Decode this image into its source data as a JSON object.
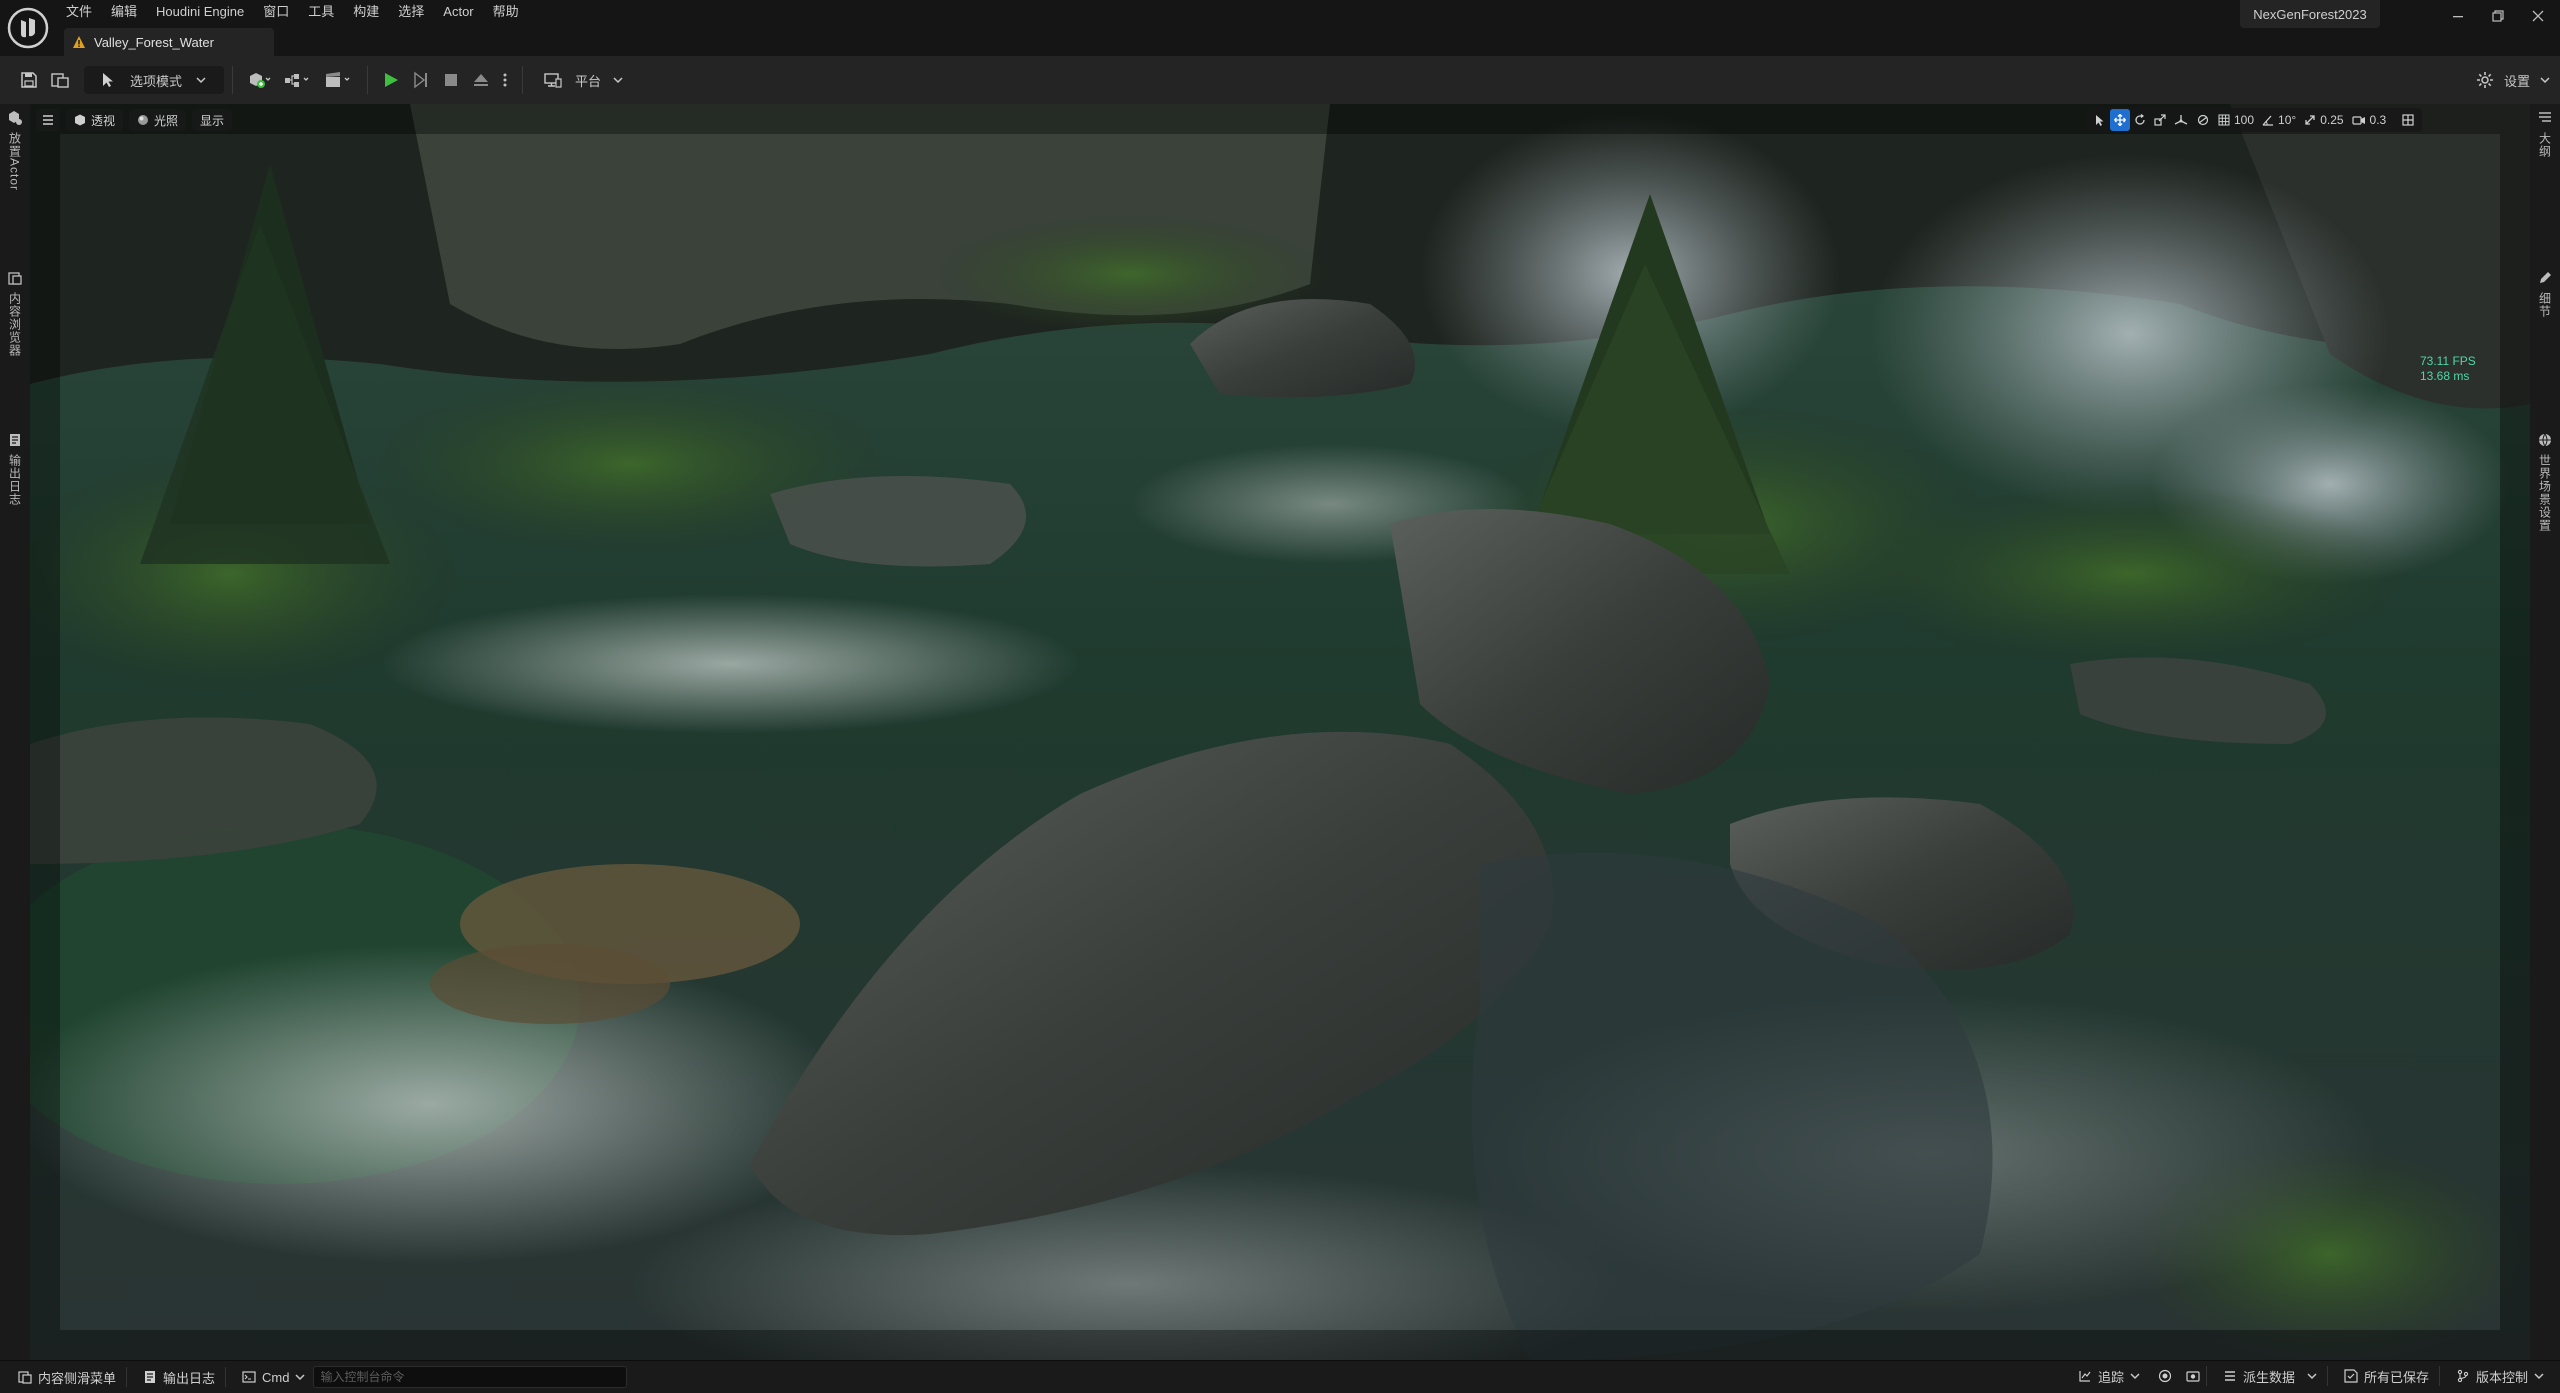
{
  "menu": [
    "文件",
    "编辑",
    "Houdini Engine",
    "窗口",
    "工具",
    "构建",
    "选择",
    "Actor",
    "帮助"
  ],
  "document_tab": "Valley_Forest_Water",
  "project_name": "NexGenForest2023",
  "toolbar": {
    "mode_label": "选项模式",
    "platform_label": "平台",
    "settings_label": "设置"
  },
  "left_rail": [
    "放置Actor",
    "内容浏览器",
    "输出日志"
  ],
  "right_rail": [
    "大纲",
    "细节",
    "世界场景设置"
  ],
  "viewport": {
    "perspective_label": "透视",
    "lit_label": "光照",
    "show_label": "显示",
    "grid_snap": "100",
    "rotation_snap": "10°",
    "scale_snap": "0.25",
    "camera_speed": "0.3",
    "fps": "73.11 FPS",
    "frame_ms": "13.68 ms"
  },
  "statusbar": {
    "content_drawer": "内容侧滑菜单",
    "output_log": "输出日志",
    "cmd_label": "Cmd",
    "cmd_placeholder": "输入控制台命令",
    "trace_label": "追踪",
    "derived_data": "派生数据",
    "all_saved": "所有已保存",
    "source_control": "版本控制"
  },
  "colors": {
    "play_green": "#3fbf3f",
    "active_blue": "#1f6fd1",
    "fps_text": "#4fd6a8",
    "tab_warning": "#e0a020"
  }
}
